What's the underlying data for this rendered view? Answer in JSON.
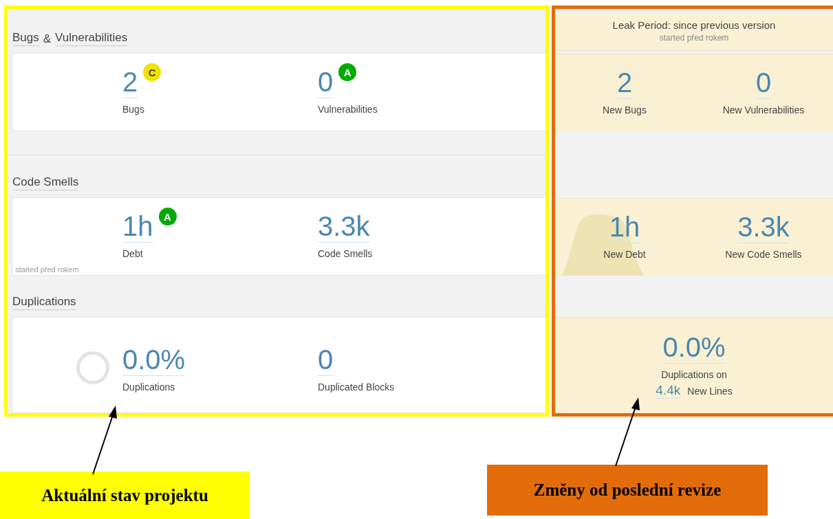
{
  "current": {
    "sections": [
      {
        "title_links": [
          "Bugs",
          "Vulnerabilities"
        ],
        "title_joiner": "&",
        "measures": [
          {
            "value": "2",
            "label": "Bugs",
            "rating": {
              "letter": "C",
              "color": "#f2e200"
            }
          },
          {
            "value": "0",
            "label": "Vulnerabilities",
            "rating": {
              "letter": "A",
              "color": "#00aa00"
            }
          }
        ]
      },
      {
        "title_links": [
          "Code Smells"
        ],
        "note": "started před rokem",
        "measures": [
          {
            "value": "1h",
            "label": "Debt",
            "rating": {
              "letter": "A",
              "color": "#00aa00"
            }
          },
          {
            "value": "3.3k",
            "label": "Code Smells"
          }
        ]
      },
      {
        "title_links": [
          "Duplications"
        ],
        "donut": true,
        "measures": [
          {
            "value": "0.0%",
            "label": "Duplications"
          },
          {
            "value": "0",
            "label": "Duplicated Blocks"
          }
        ]
      }
    ]
  },
  "leak": {
    "title": "Leak Period: since previous version",
    "subtitle": "started před rokem",
    "cards": [
      {
        "measures": [
          {
            "value": "2",
            "label": "New Bugs"
          },
          {
            "value": "0",
            "label": "New Vulnerabilities"
          }
        ]
      },
      {
        "area_chart": true,
        "measures": [
          {
            "value": "1h",
            "label": "New Debt"
          },
          {
            "value": "3.3k",
            "label": "New Code Smells"
          }
        ]
      },
      {
        "measures": [
          {
            "value": "0.0%",
            "label": "Duplications on",
            "lines_value": "4.4k",
            "lines_label": "New Lines"
          }
        ]
      }
    ]
  },
  "annotations": [
    {
      "text": "Aktuální stav projektu",
      "color": "#ffff00"
    },
    {
      "text": "Změny od poslední revize",
      "color": "#e36c0a"
    }
  ]
}
